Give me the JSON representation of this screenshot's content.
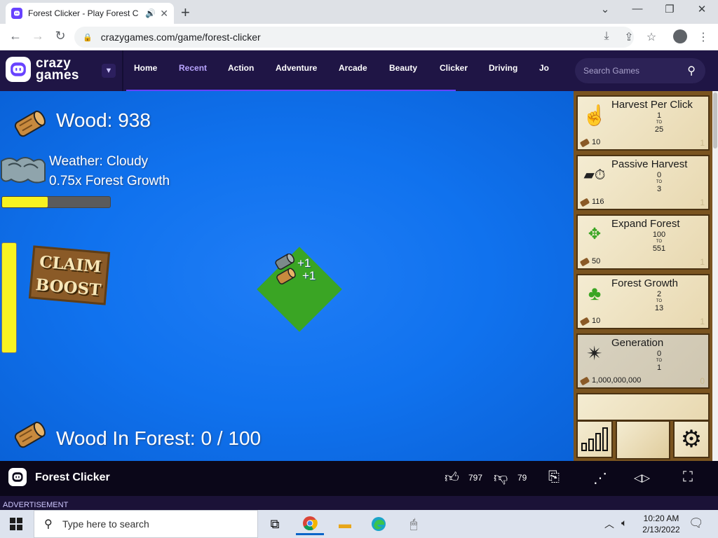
{
  "browser": {
    "tab_title": "Forest Clicker - Play Forest C",
    "tab_close": "✕",
    "new_tab": "+",
    "url": "crazygames.com/game/forest-clicker"
  },
  "site": {
    "logo_top": "crazy",
    "logo_bottom": "games",
    "nav": [
      "Home",
      "Recent",
      "Action",
      "Adventure",
      "Arcade",
      "Beauty",
      "Clicker",
      "Driving",
      "Jo"
    ],
    "active_nav": "Recent",
    "search_placeholder": "Search Games"
  },
  "game": {
    "wood_label": "Wood: 938",
    "weather": "Weather: Cloudy",
    "growth": "0.75x Forest Growth",
    "weather_progress": 0.42,
    "claim_line1": "CLAIM",
    "claim_line2": "BOOST",
    "plus1": "+1",
    "plus2": "+1",
    "wood_in_forest": "Wood In Forest: 0 / 100"
  },
  "upgrades": [
    {
      "name": "Harvest Per Click",
      "from": "1",
      "to_label": "TO",
      "to": "25",
      "cost": "10",
      "count": "1",
      "icon": "hand-pointer-icon"
    },
    {
      "name": "Passive Harvest",
      "from": "0",
      "to_label": "TO",
      "to": "3",
      "cost": "116",
      "count": "1",
      "icon": "timer-log-icon"
    },
    {
      "name": "Expand Forest",
      "from": "100",
      "to_label": "TO",
      "to": "551",
      "cost": "50",
      "count": "1",
      "icon": "expand-arrows-icon"
    },
    {
      "name": "Forest Growth",
      "from": "2",
      "to_label": "TO",
      "to": "13",
      "cost": "10",
      "count": "1",
      "icon": "tree-growth-icon"
    },
    {
      "name": "Generation",
      "from": "0",
      "to_label": "TO",
      "to": "1",
      "cost": "1,000,000,000",
      "count": "0",
      "icon": "sparkle-icon"
    }
  ],
  "footer": {
    "title": "Forest Clicker",
    "likes": "797",
    "dislikes": "79",
    "advertisement": "ADVERTISEMENT"
  },
  "taskbar": {
    "search_placeholder": "Type here to search",
    "time": "10:20 AM",
    "date": "2/13/2022"
  },
  "colors": {
    "site_header": "#1f1545",
    "accent": "#6842ff",
    "game_bg": "#1072ee",
    "progress": "#f7f321"
  }
}
